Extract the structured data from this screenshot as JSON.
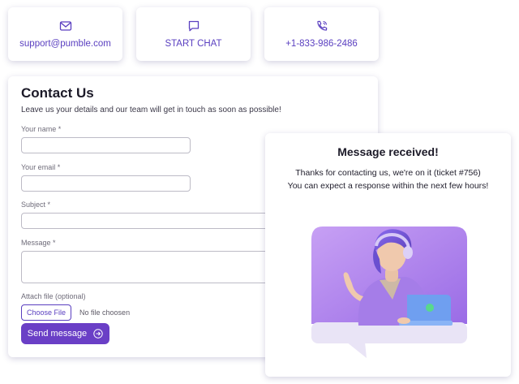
{
  "contact_options": [
    {
      "icon": "mail-icon",
      "text": "support@pumble.com"
    },
    {
      "icon": "chat-icon",
      "text": "START CHAT"
    },
    {
      "icon": "phone-icon",
      "text": "+1-833-986-2486"
    }
  ],
  "form": {
    "title": "Contact Us",
    "subtitle": "Leave us your details and our team will get in touch as soon as possible!",
    "name_label": "Your name *",
    "email_label": "Your email *",
    "subject_label": "Subject *",
    "message_label": "Message *",
    "attach_label": "Attach file (optional)",
    "choose_file": "Choose File",
    "no_file": "No file choosen",
    "send_label": "Send message"
  },
  "confirmation": {
    "title": "Message received!",
    "line1": "Thanks for contacting us, we're on it (ticket #756)",
    "line2": "You can expect a response within the next few hours!"
  },
  "colors": {
    "accent": "#6a3fc6",
    "illustration_bg": "#b98bf0"
  }
}
